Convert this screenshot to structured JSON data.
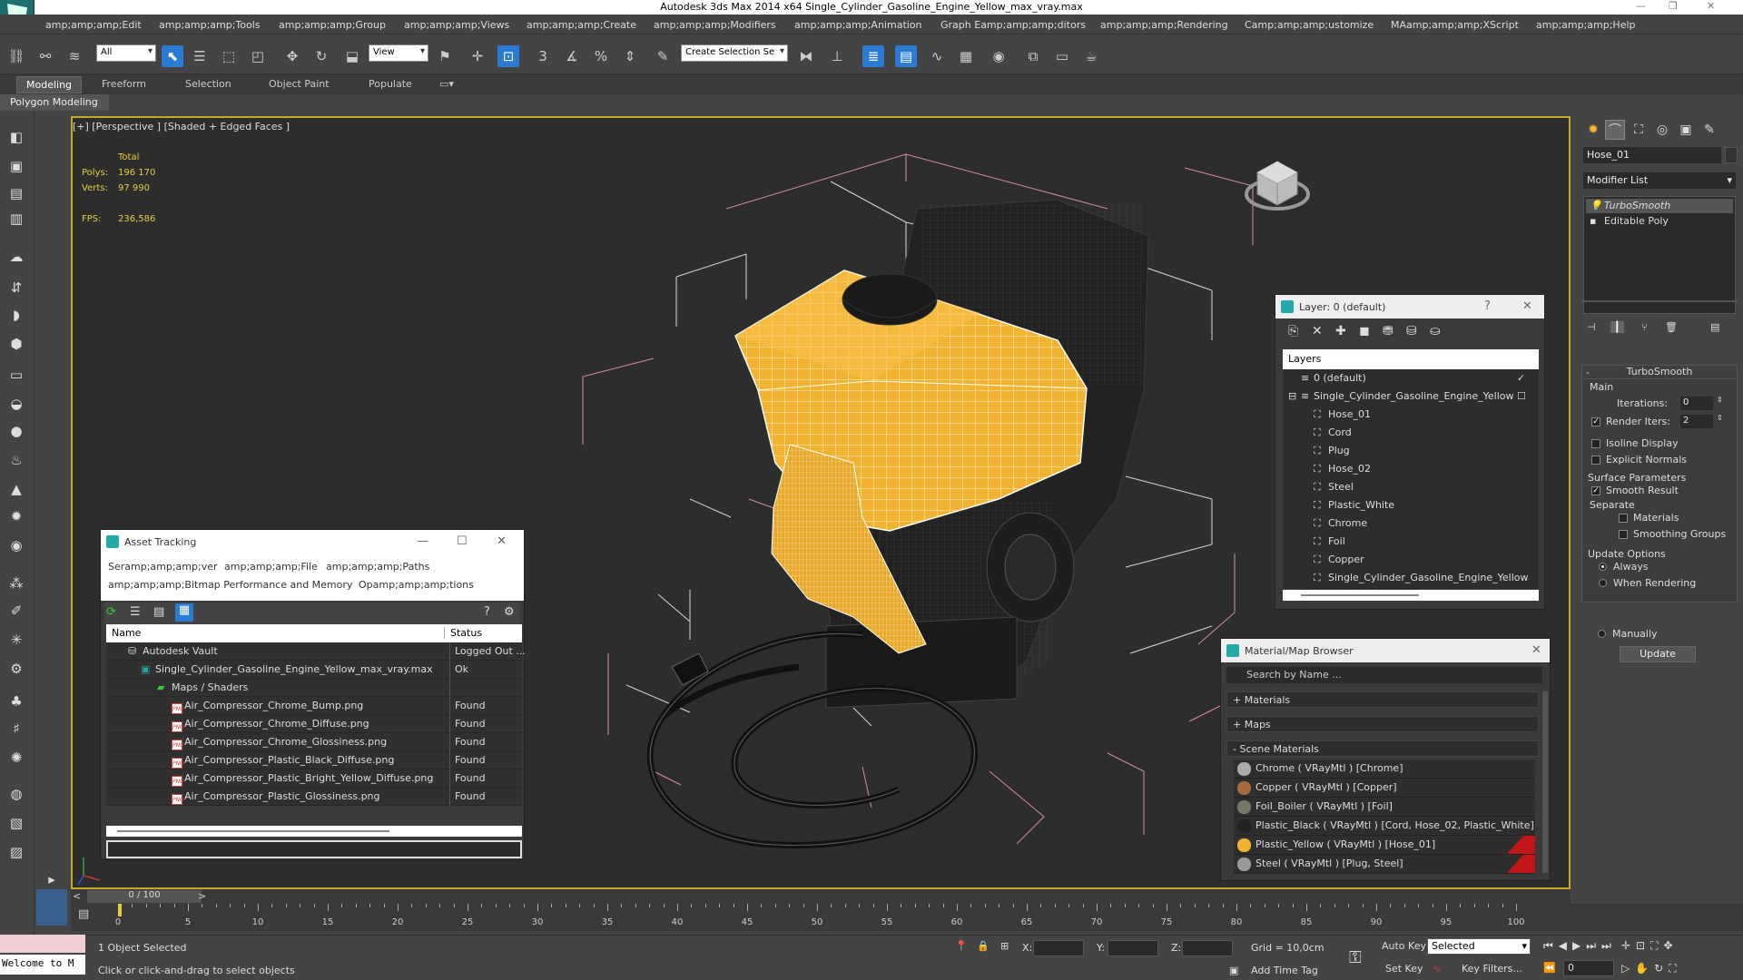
{
  "window": {
    "title": "Autodesk 3ds Max  2014 x64     Single_Cylinder_Gasoline_Engine_Yellow_max_vray.max"
  },
  "menu": [
    "amp;amp;amp;Edit",
    "amp;amp;amp;Tools",
    "amp;amp;amp;Group",
    "amp;amp;amp;Views",
    "amp;amp;amp;Create",
    "amp;amp;amp;Modifiers",
    "amp;amp;amp;Animation",
    "Graph Eamp;amp;amp;ditors",
    "amp;amp;amp;Rendering",
    "Camp;amp;amp;ustomize",
    "MAamp;amp;amp;XScript",
    "amp;amp;amp;Help"
  ],
  "toolbar": {
    "filter": "All",
    "refcoord": "View",
    "selset": "Create Selection Se"
  },
  "ribbon": {
    "tabs": [
      "Modeling",
      "Freeform",
      "Selection",
      "Object Paint",
      "Populate"
    ],
    "sub": "Polygon Modeling"
  },
  "viewport": {
    "label": "[+] [Perspective ] [Shaded + Edged Faces ]",
    "stats": {
      "total_label": "Total",
      "polys_label": "Polys:",
      "polys": "196 170",
      "verts_label": "Verts:",
      "verts": "97 990",
      "fps_label": "FPS:",
      "fps": "236,586"
    }
  },
  "asset_tracking": {
    "title": "Asset Tracking",
    "menu": [
      "Seramp;amp;amp;ver",
      "amp;amp;amp;File",
      "amp;amp;amp;Paths",
      "amp;amp;amp;Bitmap Performance and Memory",
      "Opamp;amp;amp;tions"
    ],
    "columns": [
      "Name",
      "Status"
    ],
    "rows": [
      {
        "name": "Autodesk Vault",
        "status": "Logged Out ..."
      },
      {
        "name": "Single_Cylinder_Gasoline_Engine_Yellow_max_vray.max",
        "status": "Ok"
      },
      {
        "name": "Maps / Shaders",
        "status": ""
      },
      {
        "name": "Air_Compressor_Chrome_Bump.png",
        "status": "Found"
      },
      {
        "name": "Air_Compressor_Chrome_Diffuse.png",
        "status": "Found"
      },
      {
        "name": "Air_Compressor_Chrome_Glossiness.png",
        "status": "Found"
      },
      {
        "name": "Air_Compressor_Plastic_Black_Diffuse.png",
        "status": "Found"
      },
      {
        "name": "Air_Compressor_Plastic_Bright_Yellow_Diffuse.png",
        "status": "Found"
      },
      {
        "name": "Air_Compressor_Plastic_Glossiness.png",
        "status": "Found"
      }
    ]
  },
  "layers": {
    "title": "Layer: 0 (default)",
    "header": "Layers",
    "help": "?",
    "items": [
      "0 (default)",
      "Single_Cylinder_Gasoline_Engine_Yellow",
      "Hose_01",
      "Cord",
      "Plug",
      "Hose_02",
      "Steel",
      "Plastic_White",
      "Chrome",
      "Foil",
      "Copper",
      "Single_Cylinder_Gasoline_Engine_Yellow"
    ]
  },
  "material_browser": {
    "title": "Material/Map Browser",
    "search": "Search by Name ...",
    "groups": [
      "+ Materials",
      "+ Maps",
      "- Scene Materials"
    ],
    "items": [
      "Chrome  ( VRayMtl )  [Chrome]",
      "Copper  ( VRayMtl )  [Copper]",
      "Foil_Boiler  ( VRayMtl )  [Foil]",
      "Plastic_Black  ( VRayMtl )  [Cord, Hose_02, Plastic_White]",
      "Plastic_Yellow  ( VRayMtl )  [Hose_01]",
      "Steel  ( VRayMtl )  [Plug, Steel]"
    ]
  },
  "command_panel": {
    "object_name": "Hose_01",
    "modifier_list": "Modifier List",
    "stack": [
      "TurboSmooth",
      "Editable Poly"
    ],
    "rollout": "TurboSmooth",
    "main": "Main",
    "iterations_label": "Iterations:",
    "iterations": "0",
    "render_iters_label": "Render Iters:",
    "render_iters": "2",
    "isoline": "Isoline Display",
    "explicit": "Explicit Normals",
    "surface": "Surface Parameters",
    "smooth": "Smooth Result",
    "separate": "Separate",
    "materials": "Materials",
    "smoothing": "Smoothing Groups",
    "update_options": "Update Options",
    "always": "Always",
    "when_rendering": "When Rendering",
    "manually": "Manually",
    "update": "Update"
  },
  "timeline": {
    "frame": "0 / 100",
    "ticks": [
      "0",
      "5",
      "10",
      "15",
      "20",
      "25",
      "30",
      "35",
      "40",
      "45",
      "50",
      "55",
      "60",
      "65",
      "70",
      "75",
      "80",
      "85",
      "90",
      "95",
      "100"
    ]
  },
  "status": {
    "selected": "1 Object Selected",
    "prompt": "Click or click-and-drag to select objects",
    "x": "X:",
    "y": "Y:",
    "z": "Z:",
    "grid": "Grid = 10,0cm",
    "add_time_tag": "Add Time Tag",
    "auto_key": "Auto Key",
    "set_key": "Set Key",
    "key_mode": "Selected",
    "key_filters": "Key Filters...",
    "frame": "0",
    "listener": "Welcome to M"
  },
  "colors": {
    "accent": "#2a7bd4",
    "viewport_border": "#c8a82a",
    "yellow": "#f2b430",
    "stats": "#e6cd3e"
  }
}
